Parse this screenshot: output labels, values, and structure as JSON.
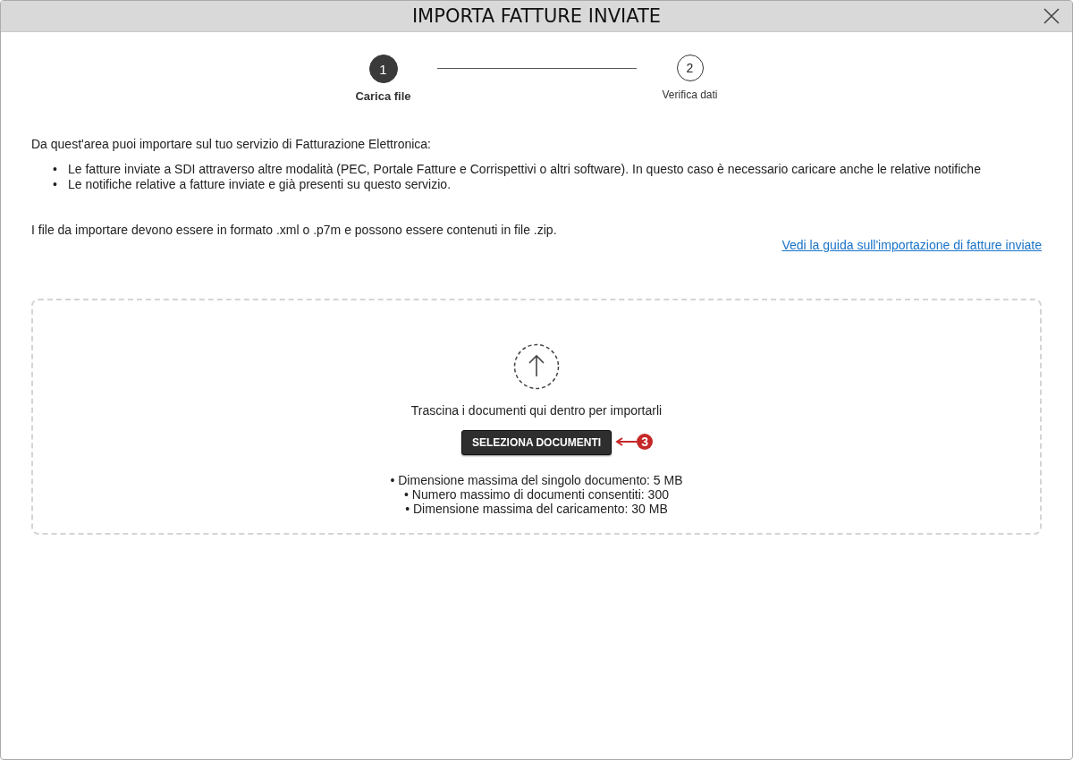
{
  "window": {
    "title": "IMPORTA FATTURE INVIATE"
  },
  "steps": [
    {
      "number": "1",
      "label": "Carica file",
      "selected": true
    },
    {
      "number": "2",
      "label": "Verifica dati",
      "selected": false
    }
  ],
  "intro": "Da quest'area puoi importare sul tuo servizio di Fatturazione Elettronica:",
  "bullets": [
    {
      "marker": "•",
      "text": "Le fatture inviate a SDI attraverso altre modalità (PEC, Portale Fatture e Corrispettivi o altri software). In questo caso è necessario caricare anche le relative notifiche"
    },
    {
      "marker": "•",
      "text": "Le notifiche relative a fatture inviate e già presenti su questo servizio."
    }
  ],
  "format_note": "I file da importare devono essere in formato .xml o .p7m e possono essere contenuti in file .zip.",
  "guide_link": "Vedi la guida sull'importazione di fatture inviate",
  "dropzone": {
    "hint": "Trascina i documenti qui dentro per importarli",
    "button": "SELEZIONA DOCUMENTI",
    "callout": "3",
    "limits": [
      "• Dimensione massima del singolo documento: 5 MB",
      "• Numero massimo di documenti consentiti: 300",
      "• Dimensione massima del caricamento: 30 MB"
    ]
  }
}
